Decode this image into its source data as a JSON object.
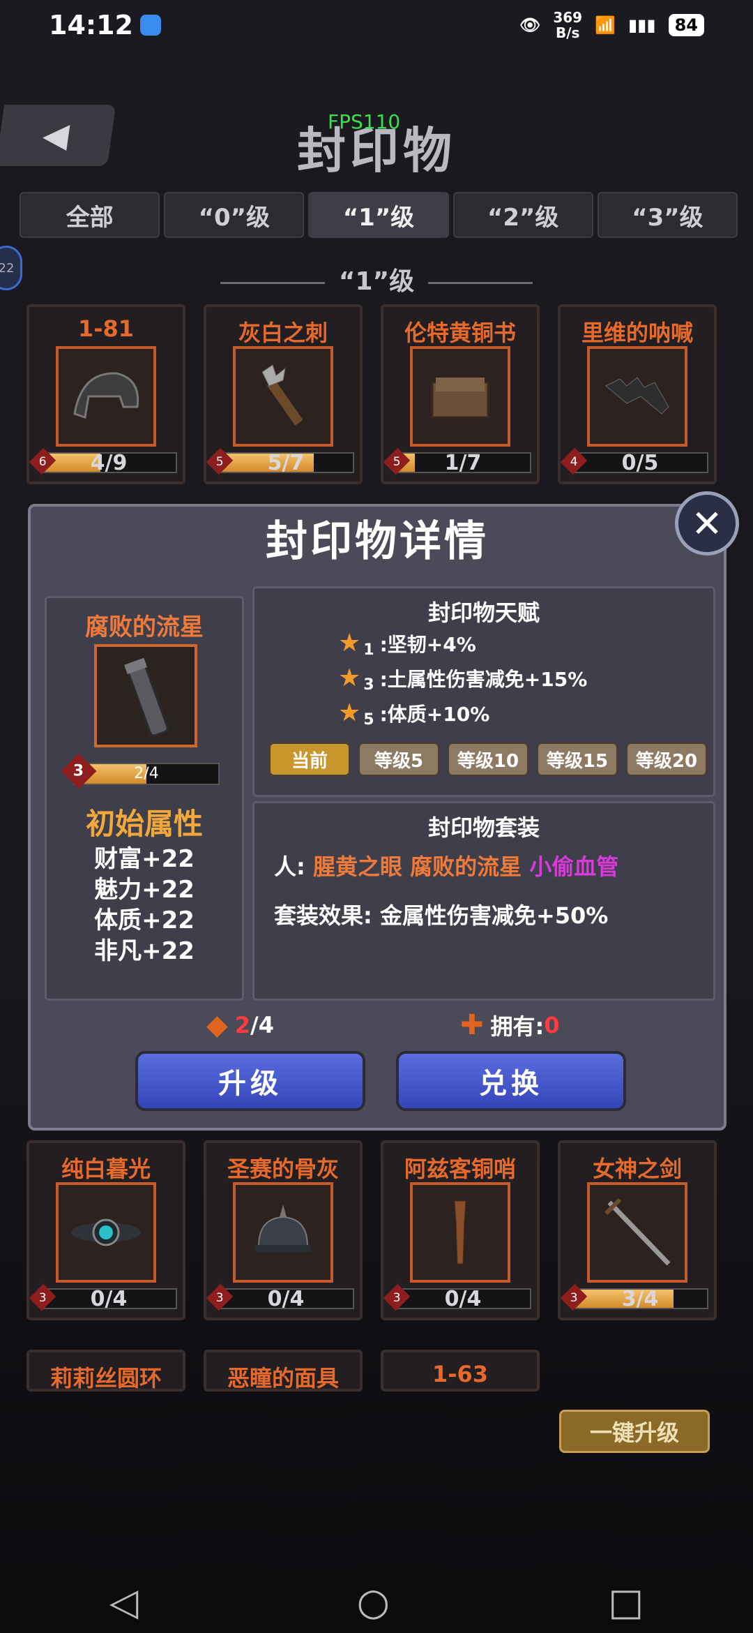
{
  "status": {
    "time": "14:12",
    "speed_value": "369",
    "speed_unit": "B/s",
    "battery": "84"
  },
  "header": {
    "title": "封印物",
    "fps": "FPS110",
    "back_icon": "back-arrow-icon"
  },
  "tabs": [
    "全部",
    "“0”级",
    "“1”级",
    "“2”级",
    "“3”级"
  ],
  "active_tab": 2,
  "side_badge": "22",
  "section_title": "“1”级",
  "cards_top": [
    {
      "name": "1-81",
      "level": "6",
      "progress": "4/9",
      "fill": 0.44
    },
    {
      "name": "灰白之刺",
      "level": "5",
      "progress": "5/7",
      "fill": 0.71
    },
    {
      "name": "伦特黄铜书",
      "level": "5",
      "progress": "1/7",
      "fill": 0.14
    },
    {
      "name": "里维的呐喊",
      "level": "4",
      "progress": "0/5",
      "fill": 0
    }
  ],
  "cards_bottom": [
    {
      "name": "纯白暮光",
      "level": "3",
      "progress": "0/4",
      "fill": 0
    },
    {
      "name": "圣赛的骨灰",
      "level": "3",
      "progress": "0/4",
      "fill": 0
    },
    {
      "name": "阿兹客铜哨",
      "level": "3",
      "progress": "0/4",
      "fill": 0
    },
    {
      "name": "女神之剑",
      "level": "3",
      "progress": "3/4",
      "fill": 0.75
    }
  ],
  "cards_partial": [
    "莉莉丝圆环",
    "恶瞳的面具",
    "1-63"
  ],
  "dialog": {
    "title": "封印物详情",
    "item_name": "腐败的流星",
    "item_level": "3",
    "item_progress": "2/4",
    "item_fill": 0.5,
    "attr_title": "初始属性",
    "attrs": [
      "财富+22",
      "魅力+22",
      "体质+22",
      "非凡+22"
    ],
    "talent_title": "封印物天赋",
    "talents": [
      {
        "stars": "1",
        "text": ":坚韧+4%"
      },
      {
        "stars": "3",
        "text": ":土属性伤害减免+15%"
      },
      {
        "stars": "5",
        "text": ":体质+10%"
      }
    ],
    "levels": [
      "当前",
      "等级5",
      "等级10",
      "等级15",
      "等级20"
    ],
    "set_title": "封印物套装",
    "set_prefix": "人:",
    "set_items": [
      "腥黄之眼",
      "腐败的流星",
      "小偷血管"
    ],
    "set_effect_label": "套装效果:",
    "set_effect": "金属性伤害减免+50%",
    "fragments_cur": "2",
    "fragments_total": "/4",
    "own_label": "拥有:",
    "own_value": "0",
    "upgrade_label": "升级",
    "exchange_label": "兑换",
    "close_icon": "close-x-icon"
  },
  "onekey_label": "一键升级",
  "nav": {
    "back": "◁",
    "home": "○",
    "recent": "□"
  }
}
